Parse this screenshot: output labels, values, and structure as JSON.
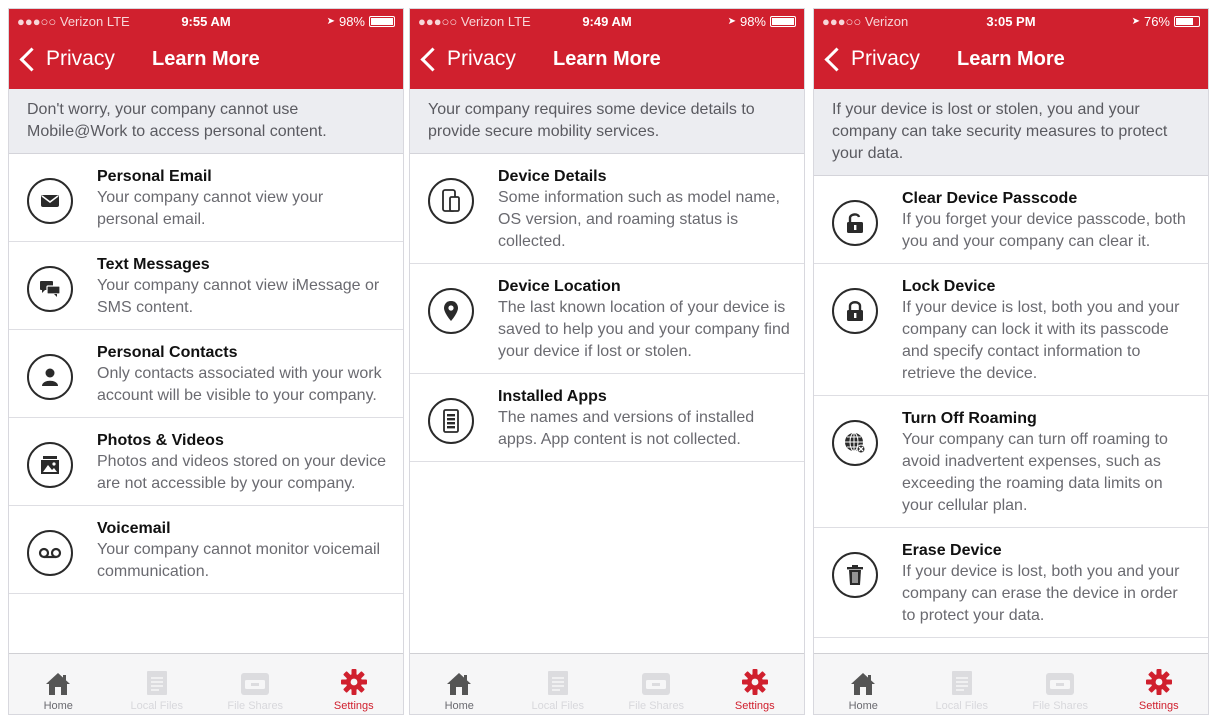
{
  "colors": {
    "brand_red": "#d0202e",
    "intro_bg": "#ecedf1"
  },
  "screens": [
    {
      "status": {
        "carrier": "●●●○○ Verizon  LTE",
        "time": "9:55 AM",
        "battery": "98%"
      },
      "nav": {
        "back_label": "Privacy",
        "title": "Learn More"
      },
      "intro": "Don't worry, your company cannot use Mobile@Work to access personal content.",
      "items": [
        {
          "icon": "email-icon",
          "title": "Personal Email",
          "desc": "Your company cannot view your personal email."
        },
        {
          "icon": "chat-icon",
          "title": "Text Messages",
          "desc": "Your company cannot view iMessage or SMS content."
        },
        {
          "icon": "contact-icon",
          "title": "Personal Contacts",
          "desc": "Only contacts associated with your work account will be visible to your company."
        },
        {
          "icon": "photo-icon",
          "title": "Photos & Videos",
          "desc": "Photos and videos stored on your device are not accessible by your company."
        },
        {
          "icon": "voicemail-icon",
          "title": "Voicemail",
          "desc": "Your company cannot monitor voicemail communication."
        }
      ]
    },
    {
      "status": {
        "carrier": "●●●○○ Verizon  LTE",
        "time": "9:49 AM",
        "battery": "98%"
      },
      "nav": {
        "back_label": "Privacy",
        "title": "Learn More"
      },
      "intro": "Your company requires some device details to provide secure mobility services.",
      "items": [
        {
          "icon": "device-icon",
          "title": "Device Details",
          "desc": "Some information such as model name, OS version, and roaming status is collected."
        },
        {
          "icon": "location-pin-icon",
          "title": "Device Location",
          "desc": "The last known location of your device is saved to help you and your company find your device if lost or stolen."
        },
        {
          "icon": "apps-icon",
          "title": "Installed Apps",
          "desc": "The names and versions of installed apps. App content is not collected."
        }
      ]
    },
    {
      "status": {
        "carrier": "●●●○○ Verizon",
        "time": "3:05 PM",
        "battery": "76%"
      },
      "nav": {
        "back_label": "Privacy",
        "title": "Learn More"
      },
      "intro": "If your device is lost or stolen, you and your company can take security measures to protect your data.",
      "items": [
        {
          "icon": "unlock-icon",
          "title": "Clear Device Passcode",
          "desc": "If you forget your device passcode, both you and your company can clear it."
        },
        {
          "icon": "lock-icon",
          "title": "Lock Device",
          "desc": "If your device is lost, both you and your company can lock it with its passcode and specify contact information to retrieve the device."
        },
        {
          "icon": "globe-icon",
          "title": "Turn Off Roaming",
          "desc": "Your company can turn off roaming to avoid inadvertent expenses, such as exceeding the roaming data limits on your cellular plan."
        },
        {
          "icon": "trash-icon",
          "title": "Erase Device",
          "desc": "If your device is lost, both you and your company can erase the device in order to protect your data."
        }
      ]
    }
  ],
  "tabbar": [
    {
      "icon": "home-icon",
      "label": "Home",
      "state": "normal"
    },
    {
      "icon": "local-files-icon",
      "label": "Local Files",
      "state": "faded"
    },
    {
      "icon": "file-shares-icon",
      "label": "File Shares",
      "state": "faded"
    },
    {
      "icon": "settings-gear-icon",
      "label": "Settings",
      "state": "active"
    }
  ]
}
